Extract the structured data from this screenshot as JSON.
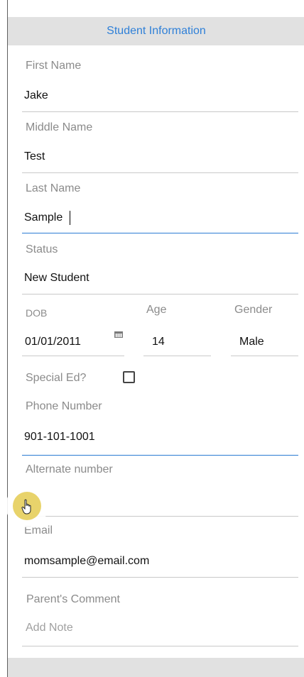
{
  "header": {
    "title": "Student Information"
  },
  "fields": {
    "first_name": {
      "label": "First Name",
      "value": "Jake"
    },
    "middle_name": {
      "label": "Middle Name",
      "value": "Test"
    },
    "last_name": {
      "label": "Last Name",
      "value": "Sample"
    },
    "status": {
      "label": "Status",
      "value": "New Student"
    },
    "dob": {
      "label": "DOB",
      "value": "01/01/2011"
    },
    "age": {
      "label": "Age",
      "value": "14"
    },
    "gender": {
      "label": "Gender",
      "value": "Male"
    },
    "special_ed": {
      "label": "Special Ed?",
      "checked": false
    },
    "phone": {
      "label": "Phone Number",
      "value": "901-101-1001"
    },
    "alternate": {
      "label": "Alternate number",
      "value": ""
    },
    "email": {
      "label": "Email",
      "value": "momsample@email.com"
    },
    "comment": {
      "label": "Parent's Comment",
      "placeholder": "Add Note"
    }
  },
  "icons": {
    "calendar": "calendar-icon",
    "pointer": "hand-pointer-icon"
  },
  "colors": {
    "header_text": "#2f80d8",
    "header_bg": "#e1e1e1",
    "active_underline": "#2b7bd3",
    "touch_indicator": "#e8d36b"
  }
}
